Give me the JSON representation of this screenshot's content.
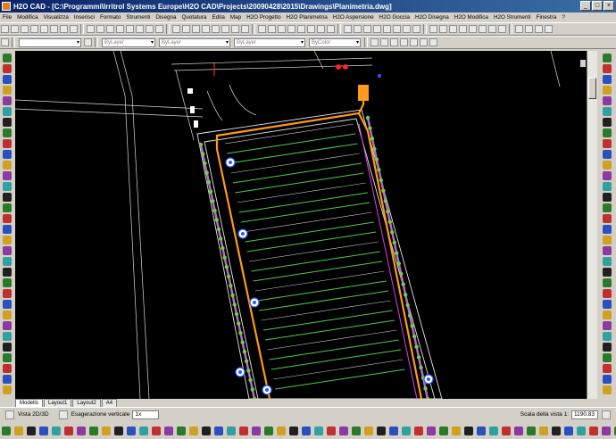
{
  "window": {
    "title": "H2O CAD - [C:\\Programmi\\Irritrol Systems Europe\\H2O CAD\\Projects\\20090428\\2015\\Drawings\\Planimetria.dwg]"
  },
  "menu": [
    "File",
    "Modifica",
    "Visualizza",
    "Inserisci",
    "Formato",
    "Strumenti",
    "Disegna",
    "Quotatura",
    "Edita",
    "Map",
    "H2O Progetto",
    "H2O Planimetria",
    "H2O Aspersione",
    "H2O Goccia",
    "H2O Disegna",
    "H2O Modifica",
    "H2O Strumenti",
    "Finestra",
    "?"
  ],
  "toolbar2": {
    "layer_combo": "ByLayer",
    "linetype_combo": "ByLayer",
    "lineweight_combo": "ByLayer",
    "color_combo": "ByColor"
  },
  "tabs": [
    "Modello",
    "Layout1",
    "Layout2",
    "A4"
  ],
  "statusbar": {
    "view_label": "Vista 2D/3D",
    "exag_label": "Esagerazione verticale",
    "exag_value": "1x",
    "scale_label": "Scala della vista 1:",
    "scale_value": "1190.83"
  },
  "colors": {
    "canvas": "#000000",
    "pipe_main": "#ff9a1a",
    "lateral_green": "#4ec94e",
    "hedge_purple": "#b070c0",
    "zone_magenta": "#e040e0",
    "outline": "#d8d8d8"
  }
}
